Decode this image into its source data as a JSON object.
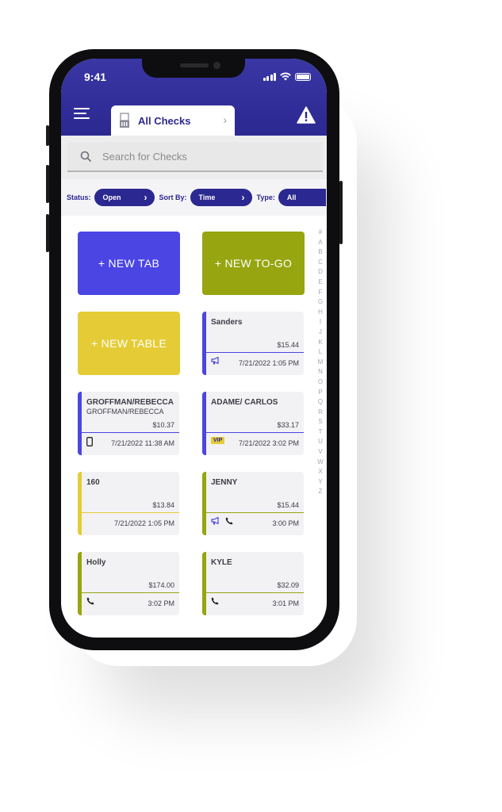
{
  "status_bar": {
    "time": "9:41"
  },
  "header": {
    "tab_label": "All Checks",
    "menu_icon": "hamburger-menu-icon",
    "tab_icon": "receipt-icon",
    "alert_icon": "warning-icon",
    "header_color": "#2c2891"
  },
  "search": {
    "placeholder": "Search for Checks"
  },
  "filters": {
    "status_label": "Status:",
    "status_value": "Open",
    "sort_label": "Sort By:",
    "sort_value": "Time",
    "type_label": "Type:",
    "type_value": "All"
  },
  "alphabet": [
    "#",
    "A",
    "B",
    "C",
    "D",
    "E",
    "F",
    "G",
    "H",
    "I",
    "J",
    "K",
    "L",
    "M",
    "N",
    "O",
    "P",
    "Q",
    "R",
    "S",
    "T",
    "U",
    "V",
    "W",
    "X",
    "Y",
    "Z"
  ],
  "actions": {
    "new_tab": {
      "label": "+ NEW TAB",
      "color": "#4b45e4"
    },
    "new_togo": {
      "label": "+ NEW TO-GO",
      "color": "#96a510"
    },
    "new_table": {
      "label": "+ NEW TABLE",
      "color": "#e5cc36"
    }
  },
  "checks": [
    {
      "name": "Sanders",
      "sub": "",
      "amount": "$15.44",
      "datetime": "7/21/2022 1:05 PM",
      "accent": "#4b45e4",
      "icons": [
        "megaphone-icon"
      ]
    },
    {
      "name": "GROFFMAN/REBECCA",
      "sub": "GROFFMAN/REBECCA",
      "amount": "$10.37",
      "datetime": "7/21/2022 11:38 AM",
      "accent": "#4b45e4",
      "icons": [
        "mobile-phone-icon"
      ]
    },
    {
      "name": "ADAME/ CARLOS",
      "sub": "",
      "amount": "$33.17",
      "datetime": "7/21/2022 3:02 PM",
      "accent": "#4b45e4",
      "icons": [
        "vip-badge"
      ],
      "badge": "VIP"
    },
    {
      "name": "160",
      "sub": "",
      "amount": "$13.84",
      "datetime": "7/21/2022 1:05 PM",
      "accent": "#e5cc36",
      "icons": []
    },
    {
      "name": "JENNY",
      "sub": "",
      "amount": "$15.44",
      "datetime": "3:00 PM",
      "accent": "#96a510",
      "icons": [
        "megaphone-icon",
        "phone-icon"
      ]
    },
    {
      "name": "Holly",
      "sub": "",
      "amount": "$174.00",
      "datetime": "3:02 PM",
      "accent": "#96a510",
      "icons": [
        "phone-icon"
      ]
    },
    {
      "name": "KYLE",
      "sub": "",
      "amount": "$32.09",
      "datetime": "3:01 PM",
      "accent": "#96a510",
      "icons": [
        "phone-icon"
      ]
    }
  ]
}
